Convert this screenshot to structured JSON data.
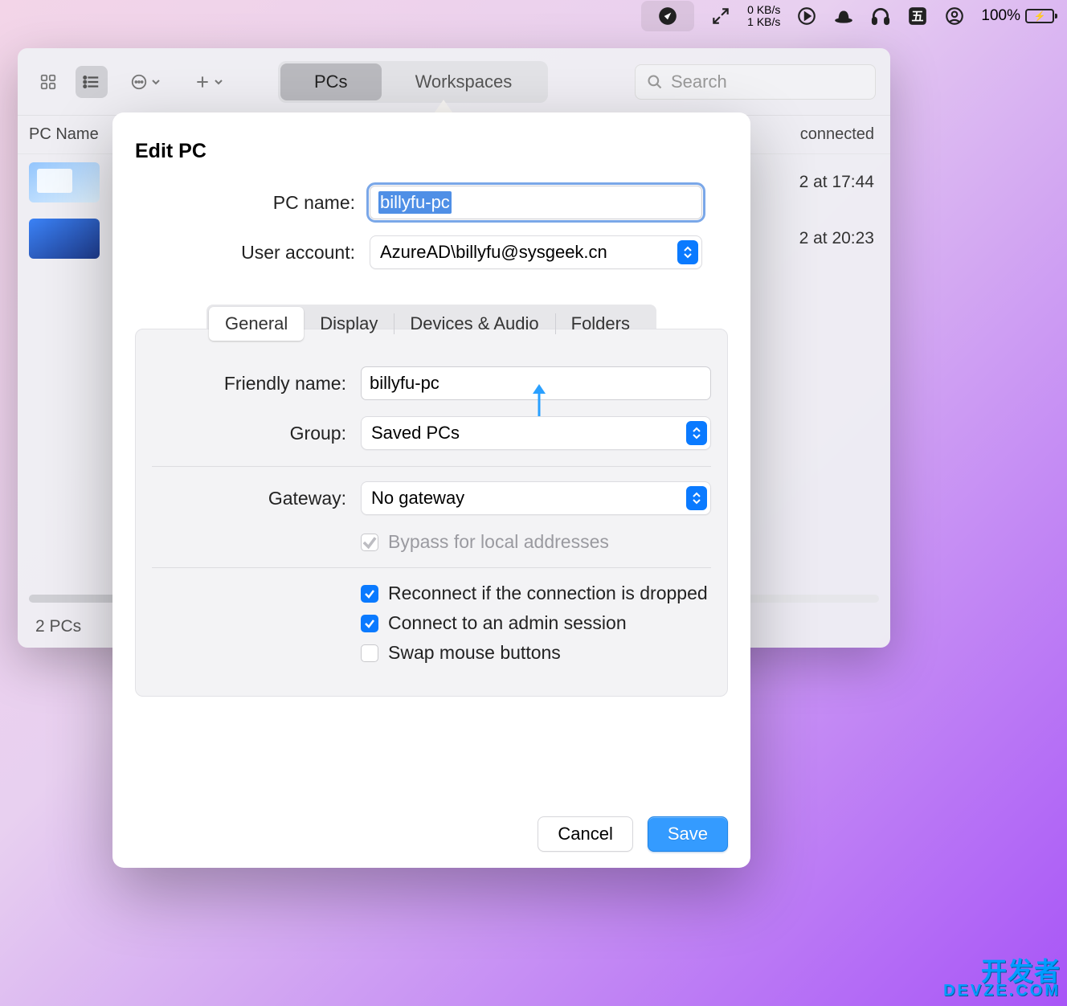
{
  "menubar": {
    "network": {
      "up": "0 KB/s",
      "down": "1 KB/s"
    },
    "battery_pct": "100%"
  },
  "window": {
    "tabs": {
      "pcs": "PCs",
      "workspaces": "Workspaces"
    },
    "search_placeholder": "Search",
    "columns": {
      "pc": "PC Name",
      "connected": "connected"
    },
    "rows": [
      {
        "time": "2 at 17:44"
      },
      {
        "time": "2 at 20:23"
      }
    ],
    "status": "2 PCs"
  },
  "sheet": {
    "title": "Edit PC",
    "pc_name_label": "PC name:",
    "pc_name_value": "billyfu-pc",
    "user_account_label": "User account:",
    "user_account_value": "AzureAD\\billyfu@sysgeek.cn",
    "tabs": {
      "general": "General",
      "display": "Display",
      "devices": "Devices & Audio",
      "folders": "Folders"
    },
    "friendly_label": "Friendly name:",
    "friendly_value": "billyfu-pc",
    "group_label": "Group:",
    "group_value": "Saved PCs",
    "gateway_label": "Gateway:",
    "gateway_value": "No gateway",
    "bypass_label": "Bypass for local addresses",
    "reconnect_label": "Reconnect if the connection is dropped",
    "admin_label": "Connect to an admin session",
    "swap_label": "Swap mouse buttons",
    "cancel": "Cancel",
    "save": "Save"
  },
  "watermark": {
    "line1": "开发者",
    "line2": "DEVZE.COM"
  }
}
